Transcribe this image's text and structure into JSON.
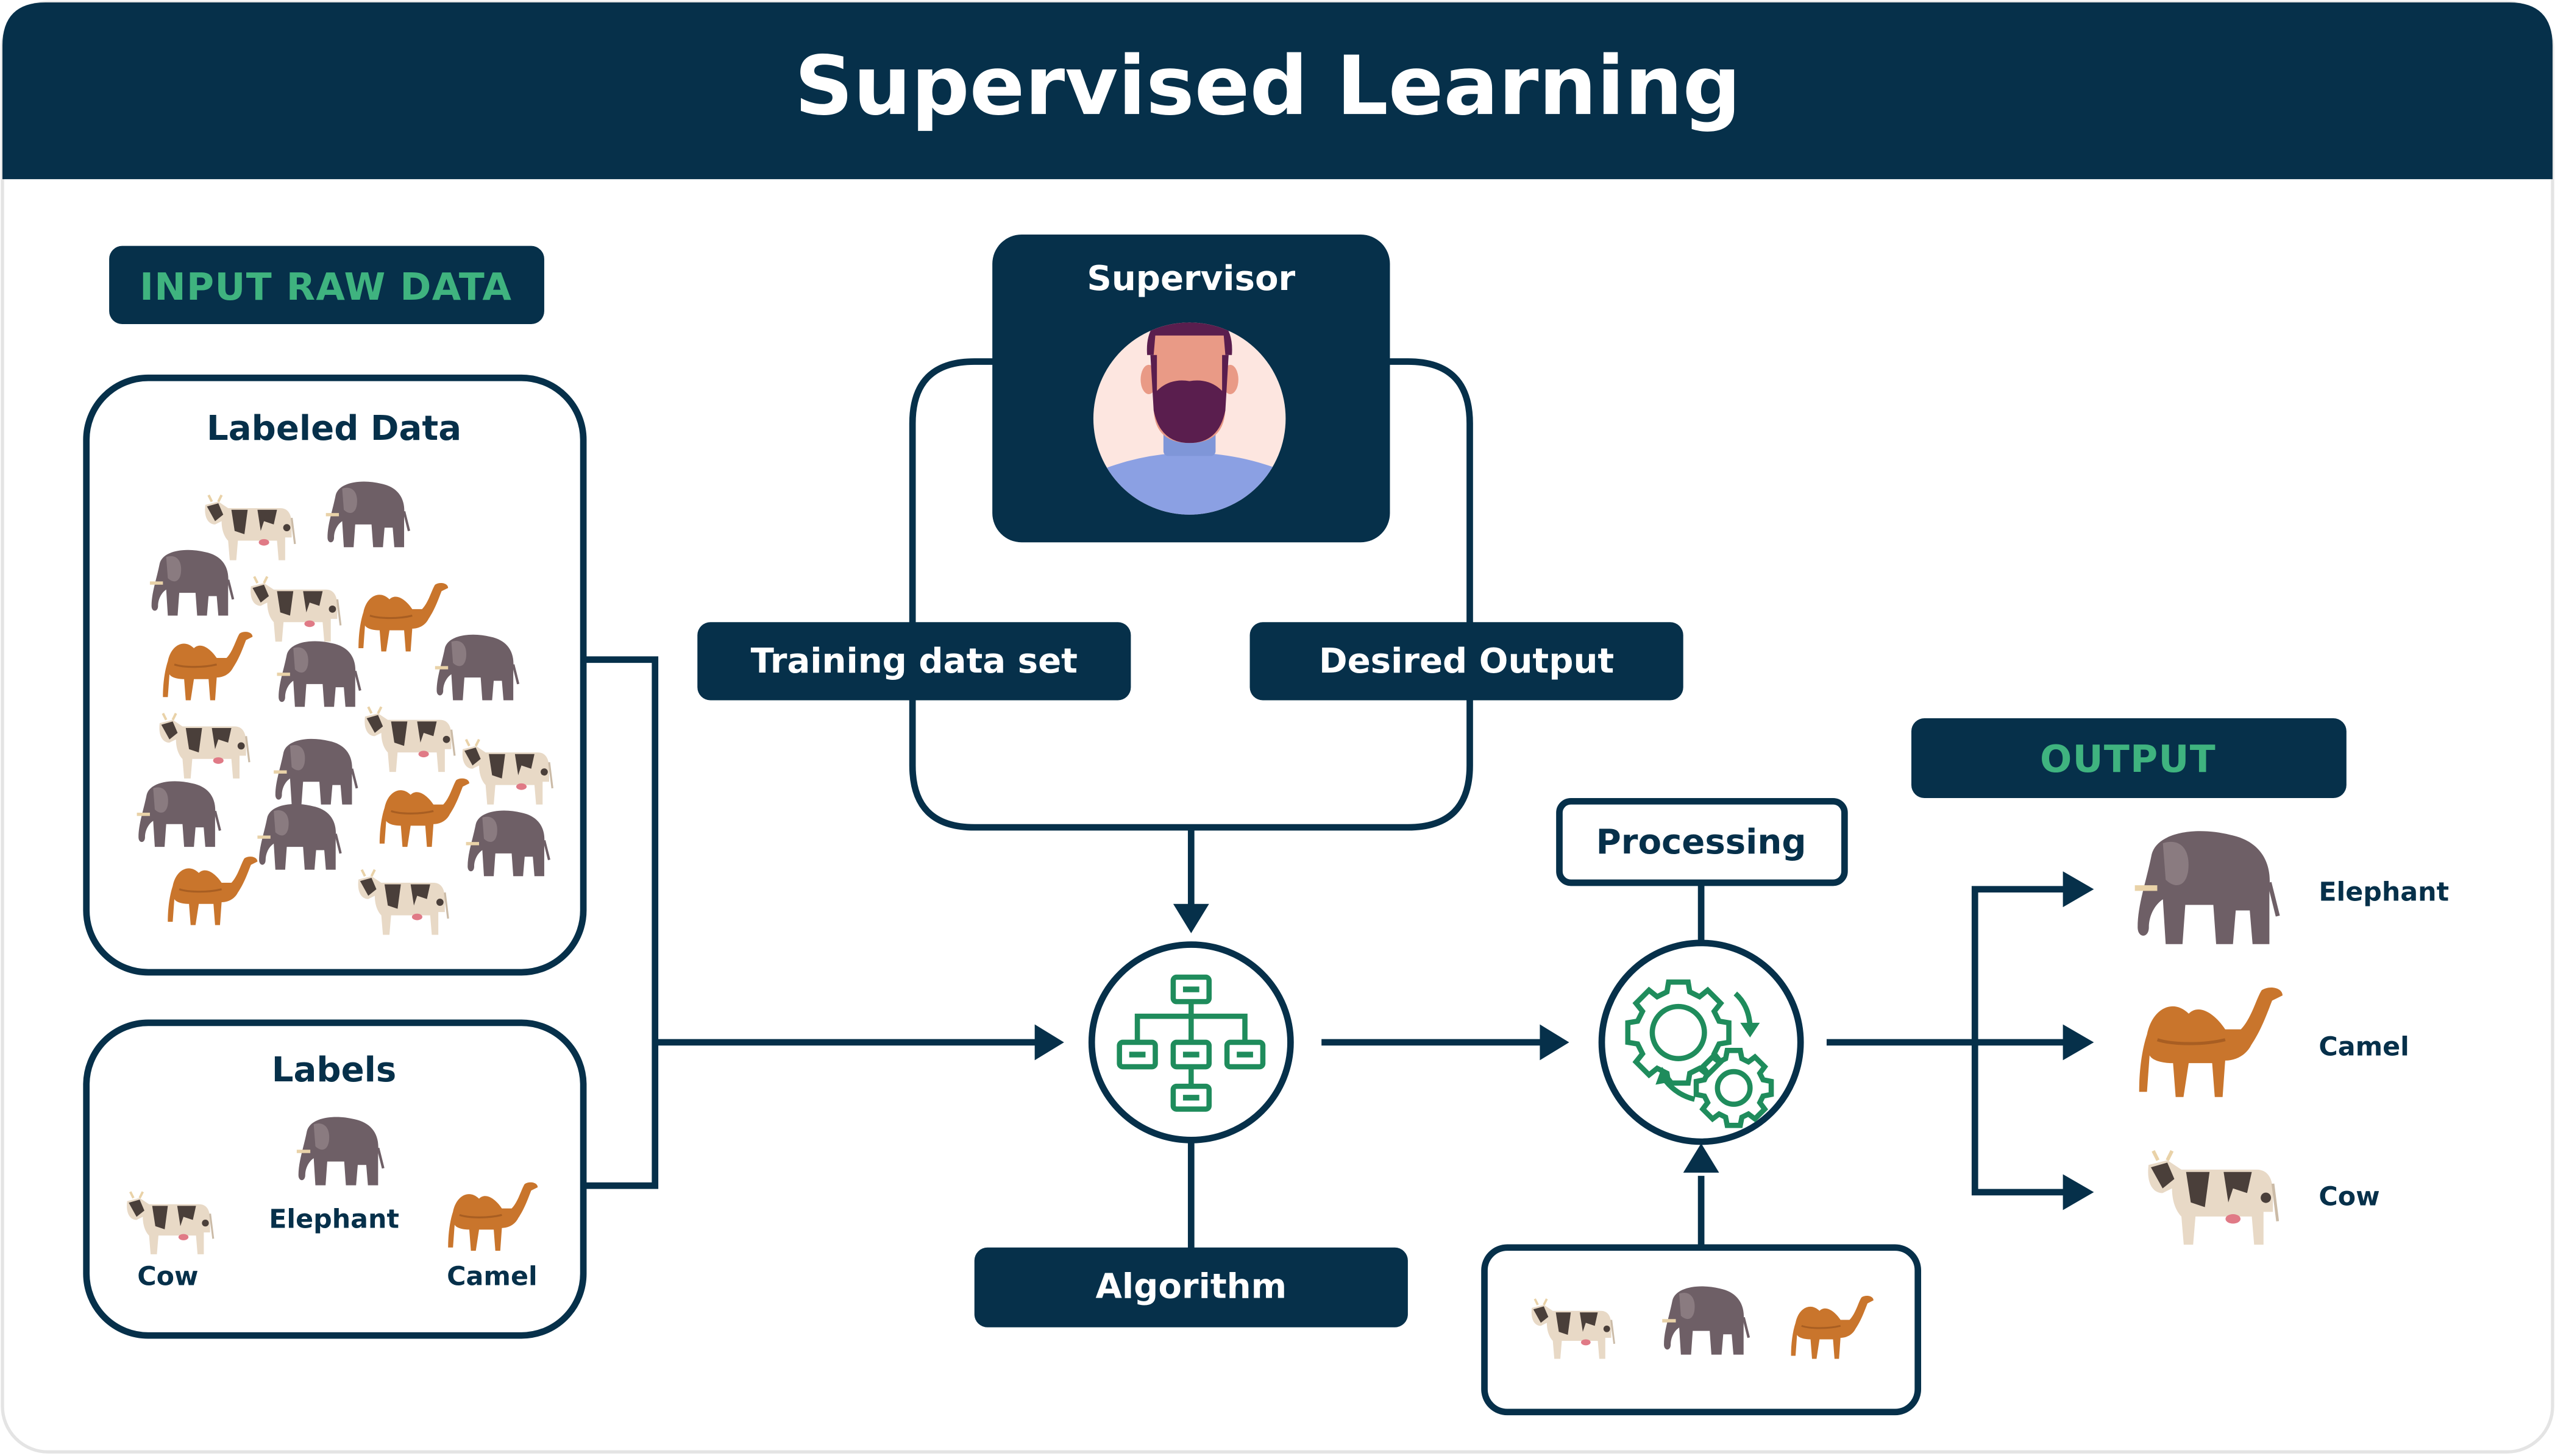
{
  "header": {
    "title": "Supervised Learning"
  },
  "colors": {
    "navy": "#06304a",
    "green_text": "#3fb37f",
    "icon_green": "#1f8c5c",
    "background": "#ffffff",
    "elephant": "#6e5f66",
    "camel": "#c9752c",
    "cow_body": "#e8d9c6",
    "cow_spots": "#4a3f3a"
  },
  "input_section": {
    "heading": "INPUT RAW DATA",
    "labeled_data": {
      "title": "Labeled Data",
      "animals": [
        "cow",
        "elephant",
        "elephant",
        "cow",
        "camel",
        "camel",
        "elephant",
        "elephant",
        "cow",
        "cow",
        "elephant",
        "cow",
        "elephant",
        "elephant",
        "camel",
        "elephant",
        "camel",
        "cow"
      ]
    },
    "labels": {
      "title": "Labels",
      "items": [
        {
          "animal": "cow",
          "label": "Cow"
        },
        {
          "animal": "elephant",
          "label": "Elephant"
        },
        {
          "animal": "camel",
          "label": "Camel"
        }
      ]
    }
  },
  "supervisor": {
    "title": "Supervisor",
    "avatar": "bearded-man-avatar"
  },
  "training_data_set": {
    "label": "Training data set"
  },
  "desired_output": {
    "label": "Desired Output"
  },
  "algorithm": {
    "label": "Algorithm",
    "icon": "hierarchy-icon"
  },
  "processing": {
    "label": "Processing",
    "icon": "gears-cycle-icon",
    "input_animals": [
      "cow",
      "elephant",
      "camel"
    ]
  },
  "output_section": {
    "heading": "OUTPUT",
    "items": [
      {
        "animal": "elephant",
        "label": "Elephant"
      },
      {
        "animal": "camel",
        "label": "Camel"
      },
      {
        "animal": "cow",
        "label": "Cow"
      }
    ]
  }
}
